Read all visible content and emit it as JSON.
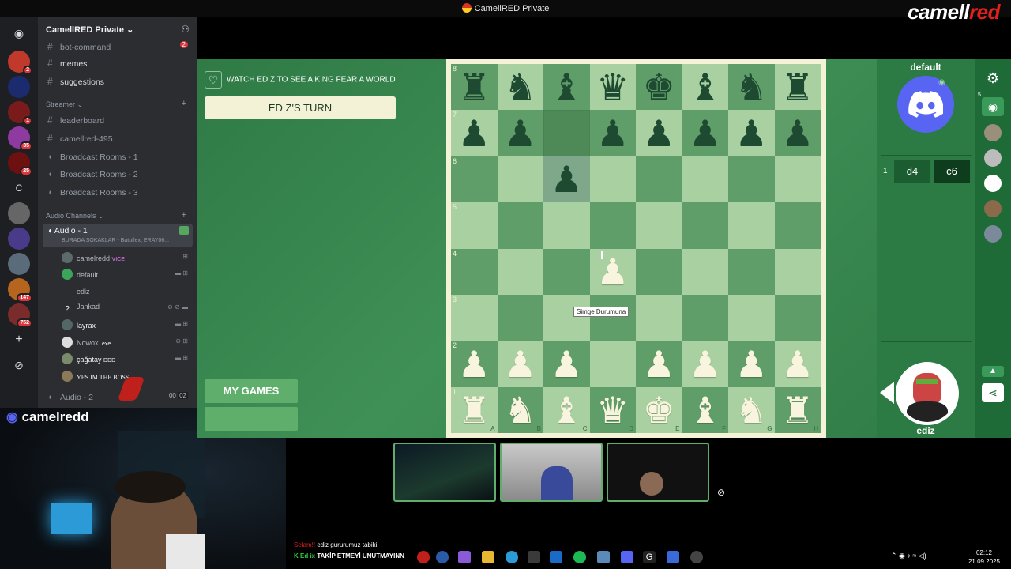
{
  "window": {
    "title": "CamellRED Private",
    "brand_left": "camell",
    "brand_right": "red"
  },
  "server": {
    "name": "CamellRED Private",
    "rail_badges": [
      "2",
      "1",
      "35",
      "25",
      "147",
      "752"
    ],
    "rail_letter": "C",
    "channels": [
      {
        "name": "bot-command",
        "type": "text",
        "badge": "2"
      },
      {
        "name": "memes",
        "type": "text"
      },
      {
        "name": "suggestions",
        "type": "text"
      }
    ],
    "streamer_category": "Streamer",
    "streamer_channels": [
      {
        "name": "leaderboard",
        "type": "text"
      },
      {
        "name": "camellred-495",
        "type": "text"
      },
      {
        "name": "Broadcast Rooms - 1",
        "type": "voice"
      },
      {
        "name": "Broadcast Rooms - 2",
        "type": "voice"
      },
      {
        "name": "Broadcast Rooms - 3",
        "type": "voice"
      }
    ],
    "audio_category": "Audio Channels",
    "audio1": {
      "name": "Audio - 1",
      "activity": "BURADA SOKAKLAR - Batuflex, ERAY06..."
    },
    "voice_users": [
      {
        "name": "camelredd",
        "tag": "VICE"
      },
      {
        "name": "default",
        "tag": ""
      },
      {
        "name": "ediz",
        "tag": ""
      },
      {
        "name": "Jankad",
        "tag": ""
      },
      {
        "name": "layrax",
        "tag": ""
      },
      {
        "name": "Nowox",
        "tag": ".exe"
      },
      {
        "name": "çağatay",
        "tag": "DDD"
      },
      {
        "name": "YES IM THE BOSS",
        "tag": ""
      }
    ],
    "audio2": {
      "name": "Audio - 2",
      "count_a": "00",
      "count_b": "02"
    }
  },
  "webcam": {
    "streamer": "camelredd"
  },
  "game": {
    "prompt": "WATCH ED Z TO SEE A K NG FEAR A WORLD",
    "turn": "ED Z'S TURN",
    "my_games": "MY GAMES",
    "tooltip": "Simge Durumuna",
    "ranks": [
      "8",
      "7",
      "6",
      "5",
      "4",
      "3",
      "2",
      "1"
    ],
    "files": [
      "a",
      "b",
      "c",
      "d",
      "e",
      "f",
      "g",
      "h"
    ],
    "board": [
      [
        "r",
        "n",
        "b",
        "q",
        "k",
        "b",
        "n",
        "r"
      ],
      [
        "p",
        "p",
        "",
        "p",
        "p",
        "p",
        "p",
        "p"
      ],
      [
        "",
        "",
        "p",
        "",
        "",
        "",
        "",
        ""
      ],
      [
        "",
        "",
        "",
        "",
        "",
        "",
        "",
        ""
      ],
      [
        "",
        "",
        "",
        "P",
        "",
        "",
        "",
        ""
      ],
      [
        "",
        "",
        "",
        "",
        "",
        "",
        "",
        ""
      ],
      [
        "P",
        "P",
        "P",
        "",
        "P",
        "P",
        "P",
        "P"
      ],
      [
        "R",
        "N",
        "B",
        "Q",
        "K",
        "B",
        "N",
        "R"
      ]
    ],
    "highlighted": [
      "c7",
      "c6"
    ],
    "player_top": "default",
    "player_bottom": "ediz",
    "moves": [
      {
        "num": "1",
        "white": "d4",
        "black": "c6"
      }
    ],
    "spectators": "5"
  },
  "taskbar": {
    "chat_user": "Selam!!",
    "chat_text": "ediz gururumuz tabiki",
    "ticker_prefix": "K",
    "ticker_name": "Ed ix",
    "ticker_text": "TAKİP ETMEYİ UNUTMAYINN",
    "time": "02:12",
    "date": "21.09.2025"
  }
}
